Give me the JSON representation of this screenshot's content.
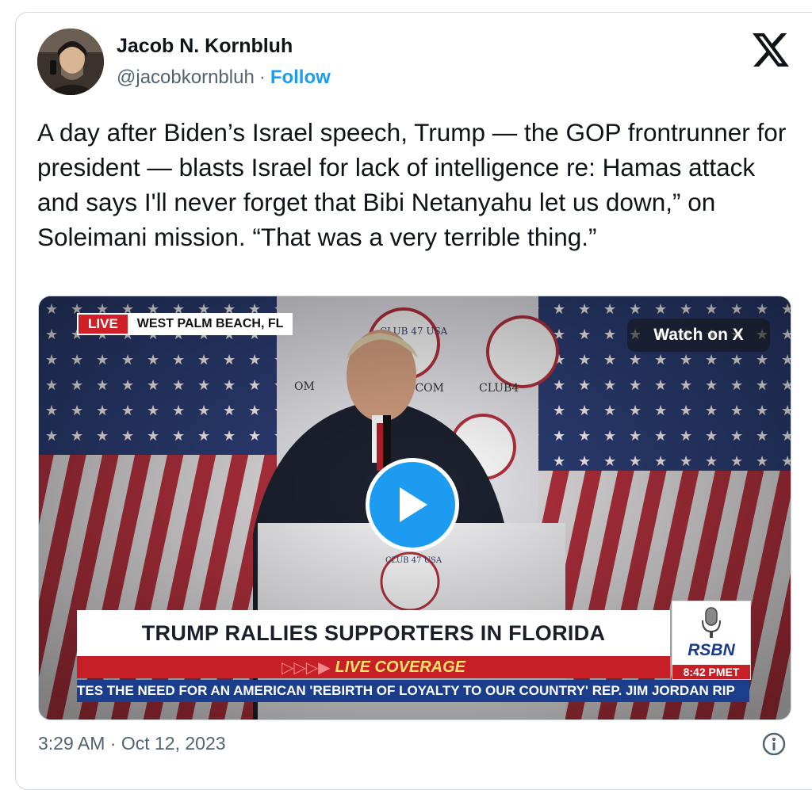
{
  "author": {
    "name": "Jacob N. Kornbluh",
    "handle": "@jacobkornbluh",
    "separator": "·",
    "follow_label": "Follow"
  },
  "tweet": {
    "text": "A day after Biden’s Israel speech, Trump — the GOP frontrunner for president — blasts Israel for lack of intelligence re: Hamas attack and says I'll never forget that Bibi Netanyahu let us down,” on Soleimani mission. “That was a very terrible thing.”"
  },
  "media": {
    "live_label": "LIVE",
    "location": "WEST PALM BEACH, FL",
    "watch_label": "Watch on X",
    "headline": "TRUMP RALLIES SUPPORTERS IN FLORIDA",
    "coverage_arrows": "▷▷▷▶",
    "coverage": "LIVE COVERAGE",
    "network": "RSBN",
    "network_time": "8:42 PMET",
    "ticker": "TES THE NEED FOR AN AMERICAN 'REBIRTH OF LOYALTY TO OUR COUNTRY'    REP. JIM JORDAN RIP",
    "backdrop_text": [
      "CLUB 47 USA",
      ".COM",
      "CLUB4",
      "OM"
    ]
  },
  "footer": {
    "timestamp": "3:29 AM · Oct 12, 2023"
  },
  "icons": [
    "x-logo-icon",
    "play-icon",
    "info-icon",
    "microphone-icon"
  ],
  "colors": {
    "accent": "#1d9bf0",
    "text": "#0f1419",
    "muted": "#536471",
    "live_red": "#c61f26",
    "ticker_blue": "#1b3e8c"
  }
}
